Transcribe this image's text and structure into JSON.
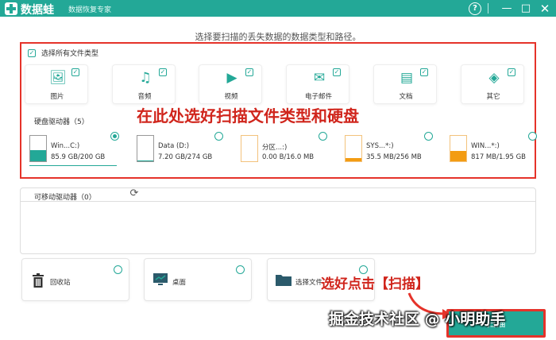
{
  "titlebar": {
    "app_name": "数据蛙",
    "app_subtitle": "数据恢复专家",
    "help": "?",
    "minimize": "—",
    "maximize": "□",
    "close": "✕"
  },
  "heading": "选择要扫描的丢失数据的数据类型和路径。",
  "select_all": {
    "label": "选择所有文件类型",
    "checked": true
  },
  "file_types": [
    {
      "label": "图片",
      "icon": "image-icon",
      "glyph": "🖼",
      "checked": true
    },
    {
      "label": "音频",
      "icon": "music-icon",
      "glyph": "♫",
      "checked": true
    },
    {
      "label": "视频",
      "icon": "video-icon",
      "glyph": "▶",
      "checked": true
    },
    {
      "label": "电子邮件",
      "icon": "email-icon",
      "glyph": "✉",
      "checked": true
    },
    {
      "label": "文档",
      "icon": "document-icon",
      "glyph": "▤",
      "checked": true
    },
    {
      "label": "其它",
      "icon": "other-icon",
      "glyph": "◈",
      "checked": true
    }
  ],
  "annotation_top": "在此处选好扫描文件类型和硬盘",
  "hard_disks": {
    "heading": "硬盘驱动器（5）",
    "drives": [
      {
        "name": "Win...C:)",
        "size": "85.9 GB/200 GB",
        "selected": true,
        "used": 0.43,
        "color": "#23a897"
      },
      {
        "name": "Data (D:)",
        "size": "7.20 GB/274 GB",
        "selected": false,
        "used": 0.03,
        "color": "#23a897"
      },
      {
        "name": "分区...:)",
        "size": "0.00  B/16.0 MB",
        "selected": false,
        "used": 0.0,
        "color": "#f39c12"
      },
      {
        "name": "SYS...*:)",
        "size": "35.5 MB/256 MB",
        "selected": false,
        "used": 0.14,
        "color": "#f39c12"
      },
      {
        "name": "WIN...*:)",
        "size": "817 MB/1.95 GB",
        "selected": false,
        "used": 0.42,
        "color": "#f39c12"
      }
    ]
  },
  "removable": {
    "heading": "可移动驱动器（0）"
  },
  "locations": [
    {
      "label": "回收站",
      "icon": "trash-icon",
      "glyph": "🗑"
    },
    {
      "label": "桌面",
      "icon": "desktop-icon",
      "glyph": "🖥"
    },
    {
      "label": "选择文件",
      "icon": "folder-icon",
      "glyph": "📁"
    }
  ],
  "annotation_bottom": "选好点击【扫描】",
  "scan_button": "扫描",
  "watermark": "掘金技术社区 @ 小明助手",
  "colors": {
    "accent": "#23a897",
    "annotation": "#e5332a"
  }
}
